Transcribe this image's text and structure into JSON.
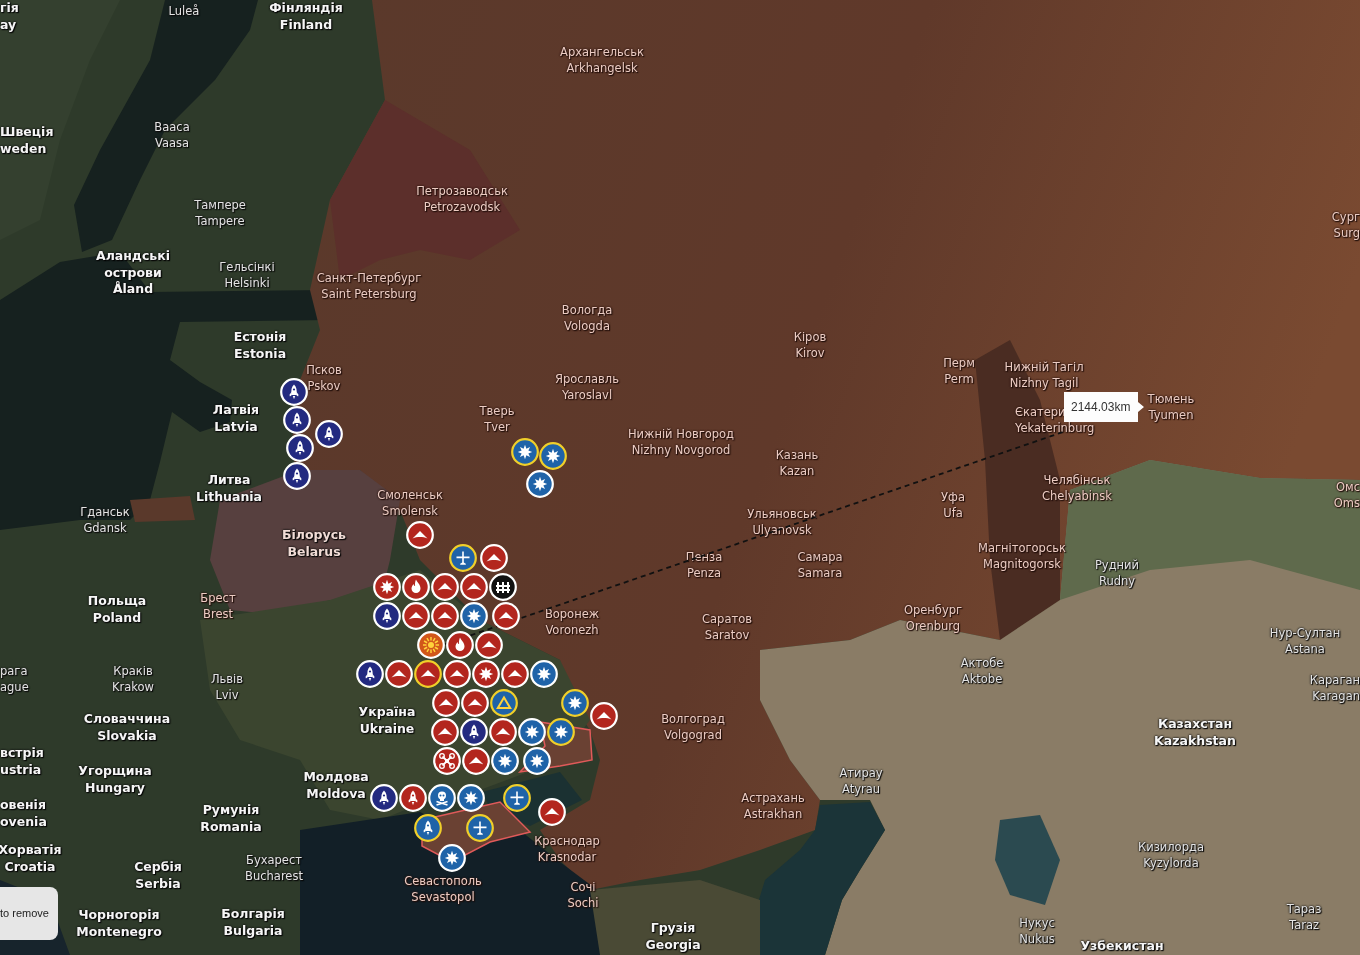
{
  "map": {
    "labels": [
      {
        "kind": "country",
        "lines": [
          "гія",
          "ay"
        ]
      },
      {
        "kind": "city",
        "lines": [
          "Luleå"
        ]
      },
      {
        "kind": "country",
        "lines": [
          "Фінляндія",
          "Finland"
        ]
      },
      {
        "kind": "city",
        "lines": [
          "Архангельськ",
          "Arkhangelsk"
        ]
      },
      {
        "kind": "country",
        "lines": [
          "Швеція",
          "weden"
        ]
      },
      {
        "kind": "city",
        "lines": [
          "Baaca",
          "Vaasa"
        ]
      },
      {
        "kind": "city",
        "lines": [
          "Петрозаводськ",
          "Petrozavodsk"
        ]
      },
      {
        "kind": "city",
        "lines": [
          "Тампере",
          "Tampere"
        ]
      },
      {
        "kind": "city",
        "lines": [
          "Сург",
          "Surg"
        ]
      },
      {
        "kind": "country",
        "lines": [
          "Аландські",
          "острови",
          "Åland"
        ]
      },
      {
        "kind": "city",
        "lines": [
          "Гельсінкі",
          "Helsinki"
        ]
      },
      {
        "kind": "city",
        "lines": [
          "Санкт-Петербург",
          "Saint Petersburg"
        ]
      },
      {
        "kind": "city",
        "lines": [
          "Вологда",
          "Vologda"
        ]
      },
      {
        "kind": "country",
        "lines": [
          "Естонія",
          "Estonia"
        ]
      },
      {
        "kind": "city",
        "lines": [
          "Кіров",
          "Kirov"
        ]
      },
      {
        "kind": "city",
        "lines": [
          "Псков",
          "Pskov"
        ]
      },
      {
        "kind": "city",
        "lines": [
          "Перм",
          "Perm"
        ]
      },
      {
        "kind": "city",
        "lines": [
          "Нижній Тагіл",
          "Nizhny Tagil"
        ]
      },
      {
        "kind": "city",
        "lines": [
          "Ярославль",
          "Yaroslavl"
        ]
      },
      {
        "kind": "country",
        "lines": [
          "Латвія",
          "Latvia"
        ]
      },
      {
        "kind": "city",
        "lines": [
          "Тверь",
          "Tver"
        ]
      },
      {
        "kind": "city",
        "lines": [
          "Тюмень",
          "Tyumen"
        ]
      },
      {
        "kind": "city",
        "lines": [
          "Єкатери",
          "Yekaterinburg"
        ]
      },
      {
        "kind": "city",
        "lines": [
          "Нижній Новгород",
          "Nizhny Novgorod"
        ]
      },
      {
        "kind": "city",
        "lines": [
          "Казань",
          "Kazan"
        ]
      },
      {
        "kind": "country",
        "lines": [
          "Литва",
          "Lithuania"
        ]
      },
      {
        "kind": "city",
        "lines": [
          "Челябінськ",
          "Chelyabinsk"
        ]
      },
      {
        "kind": "city",
        "lines": [
          "Омс",
          "Oms"
        ]
      },
      {
        "kind": "city",
        "lines": [
          "Смоленськ",
          "Smolensk"
        ]
      },
      {
        "kind": "city",
        "lines": [
          "Уфа",
          "Ufa"
        ]
      },
      {
        "kind": "city",
        "lines": [
          "Гданськ",
          "Gdansk"
        ]
      },
      {
        "kind": "city",
        "lines": [
          "Ульяновськ",
          "Ulyanovsk"
        ]
      },
      {
        "kind": "country",
        "lines": [
          "Білорусь",
          "Belarus"
        ]
      },
      {
        "kind": "city",
        "lines": [
          "Пенза",
          "Penza"
        ]
      },
      {
        "kind": "city",
        "lines": [
          "Самара",
          "Samara"
        ]
      },
      {
        "kind": "city",
        "lines": [
          "Магнітогорськ",
          "Magnitogorsk"
        ]
      },
      {
        "kind": "city",
        "lines": [
          "Рудний",
          "Rudny"
        ]
      },
      {
        "kind": "country",
        "lines": [
          "Польща",
          "Poland"
        ]
      },
      {
        "kind": "city",
        "lines": [
          "Брест",
          "Brest"
        ]
      },
      {
        "kind": "city",
        "lines": [
          "Воронеж",
          "Voronezh"
        ]
      },
      {
        "kind": "city",
        "lines": [
          "Саратов",
          "Saratov"
        ]
      },
      {
        "kind": "city",
        "lines": [
          "Оренбург",
          "Orenburg"
        ]
      },
      {
        "kind": "city",
        "lines": [
          "Нур-Султан",
          "Astana"
        ]
      },
      {
        "kind": "city",
        "lines": [
          "рага",
          "ague"
        ]
      },
      {
        "kind": "city",
        "lines": [
          "Краків",
          "Krakow"
        ]
      },
      {
        "kind": "city",
        "lines": [
          "Львів",
          "Lviv"
        ]
      },
      {
        "kind": "city",
        "lines": [
          "Актобе",
          "Aktobe"
        ]
      },
      {
        "kind": "city",
        "lines": [
          "Караган",
          "Karagan"
        ]
      },
      {
        "kind": "country",
        "lines": [
          "Словаччина",
          "Slovakia"
        ]
      },
      {
        "kind": "country",
        "lines": [
          "Україна",
          "Ukraine"
        ]
      },
      {
        "kind": "city",
        "lines": [
          "Волгоград",
          "Volgograd"
        ]
      },
      {
        "kind": "country",
        "lines": [
          "Казахстан",
          "Kazakhstan"
        ]
      },
      {
        "kind": "country",
        "lines": [
          "встрія",
          "ustria"
        ]
      },
      {
        "kind": "country",
        "lines": [
          "Угорщина",
          "Hungary"
        ]
      },
      {
        "kind": "country",
        "lines": [
          "Молдова",
          "Moldova"
        ]
      },
      {
        "kind": "city",
        "lines": [
          "Атирау",
          "Atyrau"
        ]
      },
      {
        "kind": "country",
        "lines": [
          "овенія",
          "ovenia"
        ]
      },
      {
        "kind": "country",
        "lines": [
          "Румунія",
          "Romania"
        ]
      },
      {
        "kind": "city",
        "lines": [
          "Астрахань",
          "Astrakhan"
        ]
      },
      {
        "kind": "country",
        "lines": [
          "Хорватія",
          "Croatia"
        ]
      },
      {
        "kind": "city",
        "lines": [
          "Краснодар",
          "Krasnodar"
        ]
      },
      {
        "kind": "city",
        "lines": [
          "Кизилорда",
          "Kyzylorda"
        ]
      },
      {
        "kind": "country",
        "lines": [
          "Сербія",
          "Serbia"
        ]
      },
      {
        "kind": "city",
        "lines": [
          "Бухарест",
          "Bucharest"
        ]
      },
      {
        "kind": "city",
        "lines": [
          "Севастополь",
          "Sevastopol"
        ]
      },
      {
        "kind": "city",
        "lines": [
          "Сочі",
          "Sochi"
        ]
      },
      {
        "kind": "country",
        "lines": [
          "Чорногорія",
          "Montenegro"
        ]
      },
      {
        "kind": "country",
        "lines": [
          "Болгарія",
          "Bulgaria"
        ]
      },
      {
        "kind": "country",
        "lines": [
          "Грузія",
          "Georgia"
        ]
      },
      {
        "kind": "city",
        "lines": [
          "Нукус",
          "Nukus"
        ]
      },
      {
        "kind": "city",
        "lines": [
          "Тараз",
          "Taraz"
        ]
      },
      {
        "kind": "country",
        "lines": [
          "Узбекистан"
        ]
      }
    ],
    "markers": [
      {
        "kind": "rocket",
        "color": "#232a80",
        "highlighted": false
      },
      {
        "kind": "rocket",
        "color": "#232a80",
        "highlighted": false
      },
      {
        "kind": "rocket",
        "color": "#232a80",
        "highlighted": false
      },
      {
        "kind": "rocket",
        "color": "#232a80",
        "highlighted": false
      },
      {
        "kind": "rocket",
        "color": "#232a80",
        "highlighted": false
      },
      {
        "kind": "starburst",
        "color": "#1f63a8",
        "highlighted": true
      },
      {
        "kind": "starburst",
        "color": "#1f63a8",
        "highlighted": true
      },
      {
        "kind": "starburst",
        "color": "#1f63a8",
        "highlighted": false
      },
      {
        "kind": "delta",
        "color": "#b3261e",
        "highlighted": false
      },
      {
        "kind": "plane",
        "color": "#1f63a8",
        "highlighted": true
      },
      {
        "kind": "delta",
        "color": "#b3261e",
        "highlighted": false
      },
      {
        "kind": "starburst",
        "color": "#b3261e",
        "highlighted": false
      },
      {
        "kind": "flame",
        "color": "#b3261e",
        "highlighted": false
      },
      {
        "kind": "delta",
        "color": "#b3261e",
        "highlighted": false
      },
      {
        "kind": "delta",
        "color": "#b3261e",
        "highlighted": false
      },
      {
        "kind": "barrier",
        "color": "#111111",
        "highlighted": false
      },
      {
        "kind": "rocket",
        "color": "#232a80",
        "highlighted": false
      },
      {
        "kind": "delta",
        "color": "#b3261e",
        "highlighted": false
      },
      {
        "kind": "delta",
        "color": "#b3261e",
        "highlighted": false
      },
      {
        "kind": "starburst",
        "color": "#1f63a8",
        "highlighted": false
      },
      {
        "kind": "delta",
        "color": "#b3261e",
        "highlighted": false
      },
      {
        "kind": "sun",
        "color": "#d2571a",
        "highlighted": false
      },
      {
        "kind": "flame",
        "color": "#b3261e",
        "highlighted": false
      },
      {
        "kind": "delta",
        "color": "#b3261e",
        "highlighted": false
      },
      {
        "kind": "rocket",
        "color": "#232a80",
        "highlighted": false
      },
      {
        "kind": "delta",
        "color": "#b3261e",
        "highlighted": false
      },
      {
        "kind": "delta",
        "color": "#b3261e",
        "highlighted": true
      },
      {
        "kind": "delta",
        "color": "#b3261e",
        "highlighted": false
      },
      {
        "kind": "starburst",
        "color": "#b3261e",
        "highlighted": false
      },
      {
        "kind": "delta",
        "color": "#b3261e",
        "highlighted": false
      },
      {
        "kind": "starburst",
        "color": "#1f63a8",
        "highlighted": false
      },
      {
        "kind": "delta",
        "color": "#b3261e",
        "highlighted": false
      },
      {
        "kind": "delta",
        "color": "#b3261e",
        "highlighted": false
      },
      {
        "kind": "triangle",
        "color": "#1f63a8",
        "highlighted": true
      },
      {
        "kind": "starburst",
        "color": "#1f63a8",
        "highlighted": true
      },
      {
        "kind": "delta",
        "color": "#b3261e",
        "highlighted": false
      },
      {
        "kind": "delta",
        "color": "#b3261e",
        "highlighted": false
      },
      {
        "kind": "rocket",
        "color": "#232a80",
        "highlighted": false
      },
      {
        "kind": "delta",
        "color": "#b3261e",
        "highlighted": false
      },
      {
        "kind": "starburst",
        "color": "#1f63a8",
        "highlighted": false
      },
      {
        "kind": "starburst",
        "color": "#1f63a8",
        "highlighted": true
      },
      {
        "kind": "quadcopter",
        "color": "#b3261e",
        "highlighted": false
      },
      {
        "kind": "delta",
        "color": "#b3261e",
        "highlighted": false
      },
      {
        "kind": "starburst",
        "color": "#1f63a8",
        "highlighted": false
      },
      {
        "kind": "starburst",
        "color": "#1f63a8",
        "highlighted": false
      },
      {
        "kind": "rocket",
        "color": "#232a80",
        "highlighted": false
      },
      {
        "kind": "rocket",
        "color": "#b3261e",
        "highlighted": false
      },
      {
        "kind": "skull",
        "color": "#1f63a8",
        "highlighted": false
      },
      {
        "kind": "starburst",
        "color": "#1f63a8",
        "highlighted": false
      },
      {
        "kind": "plane",
        "color": "#1f63a8",
        "highlighted": true
      },
      {
        "kind": "delta",
        "color": "#b3261e",
        "highlighted": false
      },
      {
        "kind": "rocket",
        "color": "#1f63a8",
        "highlighted": true
      },
      {
        "kind": "plane",
        "color": "#1f63a8",
        "highlighted": true
      },
      {
        "kind": "starburst",
        "color": "#1f63a8",
        "highlighted": false
      }
    ],
    "measurement": {
      "distance": "2144.03km"
    },
    "hint": "to remove"
  }
}
